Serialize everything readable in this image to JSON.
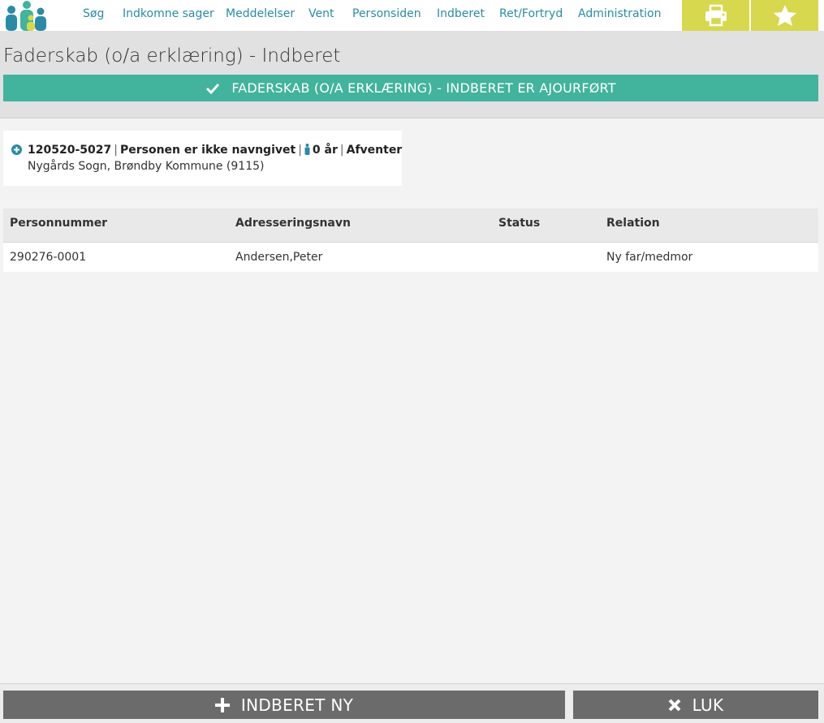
{
  "nav": {
    "items": [
      "Søg",
      "Indkomne sager",
      "Meddelelser",
      "Vent",
      "Personsiden",
      "Indberet",
      "Ret/Fortryd",
      "Administration"
    ],
    "print_icon": "printer-icon",
    "favorite_icon": "star-icon"
  },
  "colors": {
    "accent_teal": "#2a8ba6",
    "success_green": "#42b39c",
    "top_button_yellow": "#d7d84e",
    "footer_button_gray": "#6b6b6b"
  },
  "page": {
    "title": "Faderskab (o/a erklæring) - Indberet",
    "success_message": "FADERSKAB (O/A ERKLÆRING) - INDBERET ER AJOURFØRT"
  },
  "person": {
    "cpr": "120520-5027",
    "name": "Personen er ikke navngivet",
    "age": "0 år",
    "status": "Afventer",
    "location": "Nygårds Sogn, Brøndby Kommune (9115)"
  },
  "table": {
    "headers": [
      "Personnummer",
      "Adresseringsnavn",
      "Status",
      "Relation"
    ],
    "rows": [
      [
        "290276-0001",
        "Andersen,Peter",
        "",
        "Ny far/medmor"
      ]
    ]
  },
  "footer": {
    "new_label": "INDBERET NY",
    "close_label": "LUK"
  }
}
